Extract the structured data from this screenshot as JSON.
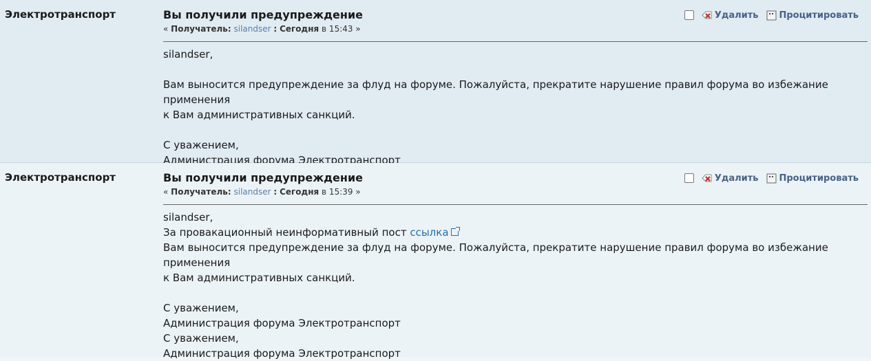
{
  "messages": [
    {
      "author": "Электротранспорт",
      "subject": "Вы получили предупреждение",
      "meta": {
        "prefix": "«",
        "recipient_label": "Получатель:",
        "recipient": "silandser",
        "sep": ":",
        "date": "Сегодня",
        "time_prefix": "в 15:43",
        "suffix": "»"
      },
      "actions": {
        "delete": "Удалить",
        "quote": "Процитировать"
      },
      "body": [
        "silandser,",
        "",
        "Вам выносится предупреждение за флуд на форуме. Пожалуйста, прекратите нарушение правил форума во избежание применения",
        "к Вам административных санкций.",
        "",
        "С уважением,",
        "Администрация форума Электротранспорт"
      ]
    },
    {
      "author": "Электротранспорт",
      "subject": "Вы получили предупреждение",
      "meta": {
        "prefix": "«",
        "recipient_label": "Получатель:",
        "recipient": "silandser",
        "sep": ":",
        "date": "Сегодня",
        "time_prefix": "в 15:39",
        "suffix": "»"
      },
      "actions": {
        "delete": "Удалить",
        "quote": "Процитировать"
      },
      "body_line1": "silandser,",
      "body_line2_text": "За провакационный неинформативный пост",
      "body_line2_link": "ссылка",
      "body_rest": [
        "Вам выносится предупреждение за флуд на форуме. Пожалуйста, прекратите нарушение правил форума во избежание применения",
        "к Вам административных санкций.",
        "",
        "С уважением,",
        "Администрация форума Электротранспорт",
        "С уважением,",
        "Администрация форума Электротранспорт"
      ]
    }
  ],
  "colors": {
    "link": "#1f6fb5",
    "recipient_link": "#5a7fa8",
    "action": "#45628a"
  }
}
